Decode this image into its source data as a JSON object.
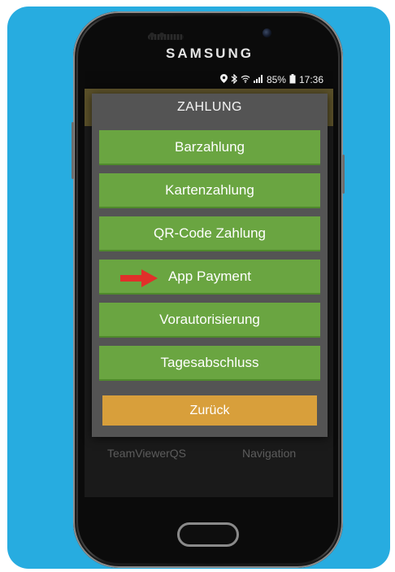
{
  "device": {
    "brand": "SAMSUNG"
  },
  "status_bar": {
    "icons": [
      "location-icon",
      "bluetooth-icon",
      "wifi-icon",
      "signal-icon",
      "battery-icon"
    ],
    "battery": "85%",
    "time": "17:36"
  },
  "background_app": {
    "labels": [
      "TeamViewerQS",
      "Navigation"
    ]
  },
  "dialog": {
    "title": "ZAHLUNG",
    "buttons": [
      "Barzahlung",
      "Kartenzahlung",
      "QR-Code Zahlung",
      "App Payment",
      "Vorautorisierung",
      "Tagesabschluss"
    ],
    "back_label": "Zurück",
    "highlighted_button": "App Payment"
  },
  "colors": {
    "background": "#27ace0",
    "button_green": "#6aa541",
    "back_orange": "#d89f3b",
    "dialog_gray": "#545454",
    "arrow_red": "#e0302a"
  }
}
